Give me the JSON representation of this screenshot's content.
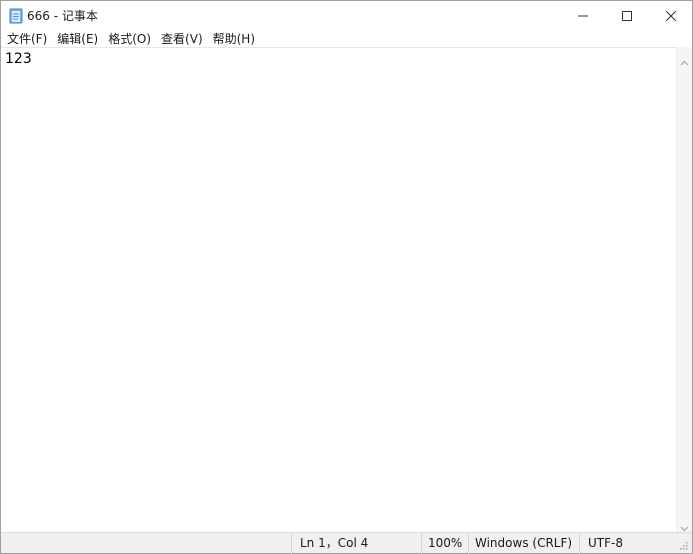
{
  "window": {
    "title": "666 - 记事本",
    "icon": "notepad-icon",
    "controls": [
      "minimize-icon",
      "maximize-icon",
      "close-icon"
    ]
  },
  "menu": {
    "items": [
      "文件(F)",
      "编辑(E)",
      "格式(O)",
      "查看(V)",
      "帮助(H)"
    ]
  },
  "editor": {
    "content": "123"
  },
  "status": {
    "position": "Ln 1，Col 4",
    "zoom": "100%",
    "line_ending": "Windows (CRLF)",
    "encoding": "UTF-8"
  },
  "colors": {
    "background": "#ffffff",
    "statusbar": "#f0f0f0",
    "text": "#000000"
  }
}
